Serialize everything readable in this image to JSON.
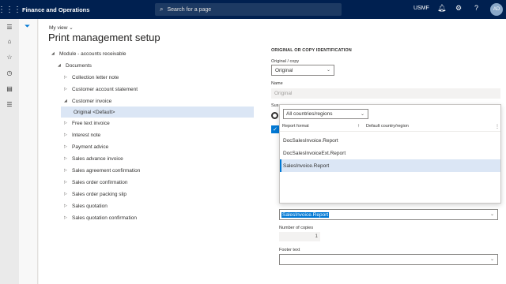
{
  "topbar": {
    "app_title": "Finance and Operations",
    "search_placeholder": "Search for a page",
    "company": "USMF",
    "avatar_initials": "AD"
  },
  "page": {
    "view_label": "My view",
    "title": "Print management setup"
  },
  "tree": [
    {
      "label": "Module - accounts receivable",
      "expanded": true
    },
    {
      "label": "Documents",
      "expanded": true
    },
    {
      "label": "Collection letter note",
      "expanded": false
    },
    {
      "label": "Customer account statement",
      "expanded": false
    },
    {
      "label": "Customer invoice",
      "expanded": true
    },
    {
      "label": "Original <Default>",
      "selected": true
    },
    {
      "label": "Free text invoice",
      "expanded": false
    },
    {
      "label": "Interest note",
      "expanded": false
    },
    {
      "label": "Payment advice",
      "expanded": false
    },
    {
      "label": "Sales advance invoice",
      "expanded": false
    },
    {
      "label": "Sales agreement confirmation",
      "expanded": false
    },
    {
      "label": "Sales order confirmation",
      "expanded": false
    },
    {
      "label": "Sales order packing slip",
      "expanded": false
    },
    {
      "label": "Sales quotation",
      "expanded": false
    },
    {
      "label": "Sales quotation confirmation",
      "expanded": false
    }
  ],
  "form": {
    "section_header": "ORIGINAL OR COPY IDENTIFICATION",
    "original_copy_label": "Original / copy",
    "original_copy_value": "Original",
    "name_label": "Name",
    "name_value": "Original",
    "suspend_label": "Sus",
    "report_format_value": "SalesInvoice.Report",
    "copies_label": "Number of copies",
    "copies_value": "1",
    "footer_label": "Footer text"
  },
  "dropdown": {
    "filter_value": "All countries/regions",
    "col_report_format": "Report format",
    "col_country": "Default country/region",
    "rows": [
      "DocSalesInvoice.Report",
      "DocSalesInvoiceExt.Report",
      "SalesInvoice.Report"
    ],
    "active_index": 2
  },
  "colors": {
    "topbar_bg": "#002050",
    "accent": "#0078d4",
    "selection_bg": "#dbe6f5"
  }
}
